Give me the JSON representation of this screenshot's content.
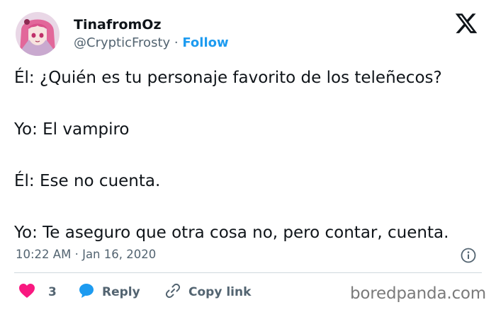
{
  "user": {
    "display_name": "TinafromOz",
    "handle": "@CrypticFrosty",
    "separator": "·",
    "follow_label": "Follow"
  },
  "tweet": {
    "lines": [
      "Él: ¿Quién es tu personaje favorito de los teleñecos?",
      "Yo: El vampiro",
      "Él: Ese no cuenta.",
      "Yo: Te aseguro que otra cosa no, pero contar, cuenta."
    ],
    "time": "10:22 AM",
    "date": "Jan 16, 2020",
    "meta_separator": "·"
  },
  "actions": {
    "like_count": "3",
    "reply_label": "Reply",
    "copy_link_label": "Copy link"
  },
  "watermark": "boredpanda.com",
  "icons": {
    "brand": "x-logo-icon",
    "like": "heart-icon",
    "reply": "speech-bubble-icon",
    "copy": "link-icon",
    "info": "info-icon"
  },
  "colors": {
    "text": "#0f1419",
    "secondary": "#536471",
    "accent": "#1d9bf0",
    "like": "#f91880"
  }
}
